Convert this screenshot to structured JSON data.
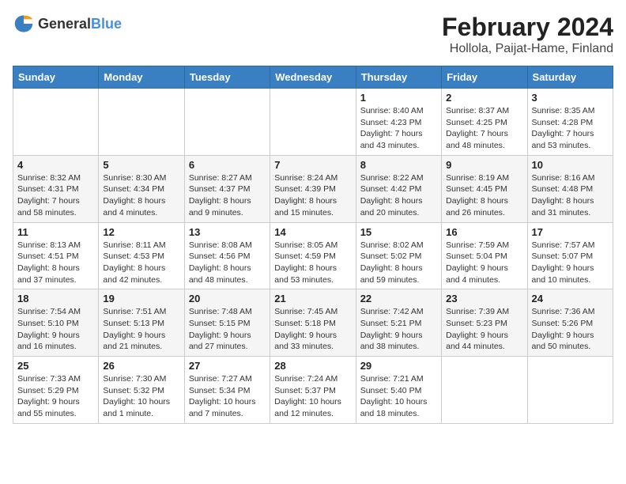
{
  "header": {
    "logo_general": "General",
    "logo_blue": "Blue",
    "month": "February 2024",
    "location": "Hollola, Paijat-Hame, Finland"
  },
  "weekdays": [
    "Sunday",
    "Monday",
    "Tuesday",
    "Wednesday",
    "Thursday",
    "Friday",
    "Saturday"
  ],
  "weeks": [
    [
      {
        "day": "",
        "sunrise": "",
        "sunset": "",
        "daylight": ""
      },
      {
        "day": "",
        "sunrise": "",
        "sunset": "",
        "daylight": ""
      },
      {
        "day": "",
        "sunrise": "",
        "sunset": "",
        "daylight": ""
      },
      {
        "day": "",
        "sunrise": "",
        "sunset": "",
        "daylight": ""
      },
      {
        "day": "1",
        "sunrise": "Sunrise: 8:40 AM",
        "sunset": "Sunset: 4:23 PM",
        "daylight": "Daylight: 7 hours and 43 minutes."
      },
      {
        "day": "2",
        "sunrise": "Sunrise: 8:37 AM",
        "sunset": "Sunset: 4:25 PM",
        "daylight": "Daylight: 7 hours and 48 minutes."
      },
      {
        "day": "3",
        "sunrise": "Sunrise: 8:35 AM",
        "sunset": "Sunset: 4:28 PM",
        "daylight": "Daylight: 7 hours and 53 minutes."
      }
    ],
    [
      {
        "day": "4",
        "sunrise": "Sunrise: 8:32 AM",
        "sunset": "Sunset: 4:31 PM",
        "daylight": "Daylight: 7 hours and 58 minutes."
      },
      {
        "day": "5",
        "sunrise": "Sunrise: 8:30 AM",
        "sunset": "Sunset: 4:34 PM",
        "daylight": "Daylight: 8 hours and 4 minutes."
      },
      {
        "day": "6",
        "sunrise": "Sunrise: 8:27 AM",
        "sunset": "Sunset: 4:37 PM",
        "daylight": "Daylight: 8 hours and 9 minutes."
      },
      {
        "day": "7",
        "sunrise": "Sunrise: 8:24 AM",
        "sunset": "Sunset: 4:39 PM",
        "daylight": "Daylight: 8 hours and 15 minutes."
      },
      {
        "day": "8",
        "sunrise": "Sunrise: 8:22 AM",
        "sunset": "Sunset: 4:42 PM",
        "daylight": "Daylight: 8 hours and 20 minutes."
      },
      {
        "day": "9",
        "sunrise": "Sunrise: 8:19 AM",
        "sunset": "Sunset: 4:45 PM",
        "daylight": "Daylight: 8 hours and 26 minutes."
      },
      {
        "day": "10",
        "sunrise": "Sunrise: 8:16 AM",
        "sunset": "Sunset: 4:48 PM",
        "daylight": "Daylight: 8 hours and 31 minutes."
      }
    ],
    [
      {
        "day": "11",
        "sunrise": "Sunrise: 8:13 AM",
        "sunset": "Sunset: 4:51 PM",
        "daylight": "Daylight: 8 hours and 37 minutes."
      },
      {
        "day": "12",
        "sunrise": "Sunrise: 8:11 AM",
        "sunset": "Sunset: 4:53 PM",
        "daylight": "Daylight: 8 hours and 42 minutes."
      },
      {
        "day": "13",
        "sunrise": "Sunrise: 8:08 AM",
        "sunset": "Sunset: 4:56 PM",
        "daylight": "Daylight: 8 hours and 48 minutes."
      },
      {
        "day": "14",
        "sunrise": "Sunrise: 8:05 AM",
        "sunset": "Sunset: 4:59 PM",
        "daylight": "Daylight: 8 hours and 53 minutes."
      },
      {
        "day": "15",
        "sunrise": "Sunrise: 8:02 AM",
        "sunset": "Sunset: 5:02 PM",
        "daylight": "Daylight: 8 hours and 59 minutes."
      },
      {
        "day": "16",
        "sunrise": "Sunrise: 7:59 AM",
        "sunset": "Sunset: 5:04 PM",
        "daylight": "Daylight: 9 hours and 4 minutes."
      },
      {
        "day": "17",
        "sunrise": "Sunrise: 7:57 AM",
        "sunset": "Sunset: 5:07 PM",
        "daylight": "Daylight: 9 hours and 10 minutes."
      }
    ],
    [
      {
        "day": "18",
        "sunrise": "Sunrise: 7:54 AM",
        "sunset": "Sunset: 5:10 PM",
        "daylight": "Daylight: 9 hours and 16 minutes."
      },
      {
        "day": "19",
        "sunrise": "Sunrise: 7:51 AM",
        "sunset": "Sunset: 5:13 PM",
        "daylight": "Daylight: 9 hours and 21 minutes."
      },
      {
        "day": "20",
        "sunrise": "Sunrise: 7:48 AM",
        "sunset": "Sunset: 5:15 PM",
        "daylight": "Daylight: 9 hours and 27 minutes."
      },
      {
        "day": "21",
        "sunrise": "Sunrise: 7:45 AM",
        "sunset": "Sunset: 5:18 PM",
        "daylight": "Daylight: 9 hours and 33 minutes."
      },
      {
        "day": "22",
        "sunrise": "Sunrise: 7:42 AM",
        "sunset": "Sunset: 5:21 PM",
        "daylight": "Daylight: 9 hours and 38 minutes."
      },
      {
        "day": "23",
        "sunrise": "Sunrise: 7:39 AM",
        "sunset": "Sunset: 5:23 PM",
        "daylight": "Daylight: 9 hours and 44 minutes."
      },
      {
        "day": "24",
        "sunrise": "Sunrise: 7:36 AM",
        "sunset": "Sunset: 5:26 PM",
        "daylight": "Daylight: 9 hours and 50 minutes."
      }
    ],
    [
      {
        "day": "25",
        "sunrise": "Sunrise: 7:33 AM",
        "sunset": "Sunset: 5:29 PM",
        "daylight": "Daylight: 9 hours and 55 minutes."
      },
      {
        "day": "26",
        "sunrise": "Sunrise: 7:30 AM",
        "sunset": "Sunset: 5:32 PM",
        "daylight": "Daylight: 10 hours and 1 minute."
      },
      {
        "day": "27",
        "sunrise": "Sunrise: 7:27 AM",
        "sunset": "Sunset: 5:34 PM",
        "daylight": "Daylight: 10 hours and 7 minutes."
      },
      {
        "day": "28",
        "sunrise": "Sunrise: 7:24 AM",
        "sunset": "Sunset: 5:37 PM",
        "daylight": "Daylight: 10 hours and 12 minutes."
      },
      {
        "day": "29",
        "sunrise": "Sunrise: 7:21 AM",
        "sunset": "Sunset: 5:40 PM",
        "daylight": "Daylight: 10 hours and 18 minutes."
      },
      {
        "day": "",
        "sunrise": "",
        "sunset": "",
        "daylight": ""
      },
      {
        "day": "",
        "sunrise": "",
        "sunset": "",
        "daylight": ""
      }
    ]
  ]
}
